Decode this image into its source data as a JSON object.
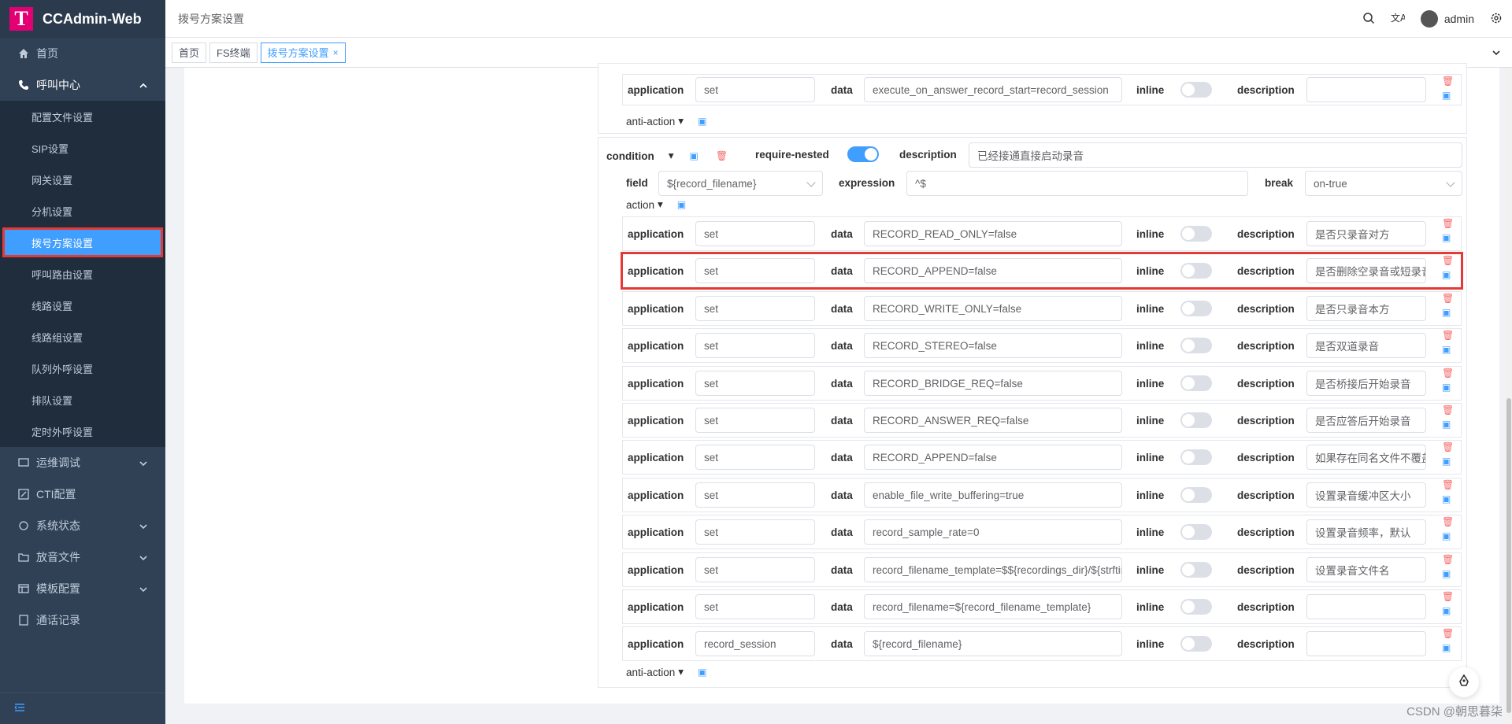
{
  "app": {
    "title": "CCAdmin-Web",
    "logo_letter": "T"
  },
  "sidebar": {
    "home": "首页",
    "callcenter": "呼叫中心",
    "callcenter_items": [
      "配置文件设置",
      "SIP设置",
      "网关设置",
      "分机设置",
      "拨号方案设置",
      "呼叫路由设置",
      "线路设置",
      "线路组设置",
      "队列外呼设置",
      "排队设置",
      "定时外呼设置"
    ],
    "active_index": 4,
    "groups": [
      "运维调试",
      "CTI配置",
      "系统状态",
      "放音文件",
      "模板配置",
      "通话记录"
    ]
  },
  "header": {
    "breadcrumb": "拨号方案设置",
    "user": "admin"
  },
  "tabs": [
    "首页",
    "FS终端",
    "拨号方案设置"
  ],
  "active_tab": 2,
  "top_row": {
    "application_label": "application",
    "application": "set",
    "data_label": "data",
    "data": "execute_on_answer_record_start=record_session",
    "inline_label": "inline",
    "description_label": "description",
    "description": ""
  },
  "anti_action_label": "anti-action",
  "condition": {
    "label": "condition",
    "require_nested_label": "require-nested",
    "require_nested": true,
    "description_label": "description",
    "description": "已经接通直接启动录音",
    "field_label": "field",
    "field": "${record_filename}",
    "expression_label": "expression",
    "expression": "^$",
    "break_label": "break",
    "break": "on-true",
    "action_label": "action"
  },
  "actions": [
    {
      "application": "set",
      "data": "RECORD_READ_ONLY=false",
      "description": "是否只录音对方"
    },
    {
      "application": "set",
      "data": "RECORD_APPEND=false",
      "description": "是否删除空录音或短录音"
    },
    {
      "application": "set",
      "data": "RECORD_WRITE_ONLY=false",
      "description": "是否只录音本方"
    },
    {
      "application": "set",
      "data": "RECORD_STEREO=false",
      "description": "是否双道录音"
    },
    {
      "application": "set",
      "data": "RECORD_BRIDGE_REQ=false",
      "description": "是否桥接后开始录音"
    },
    {
      "application": "set",
      "data": "RECORD_ANSWER_REQ=false",
      "description": "是否应答后开始录音"
    },
    {
      "application": "set",
      "data": "RECORD_APPEND=false",
      "description": "如果存在同名文件不覆盖"
    },
    {
      "application": "set",
      "data": "enable_file_write_buffering=true",
      "description": "设置录音缓冲区大小"
    },
    {
      "application": "set",
      "data": "record_sample_rate=0",
      "description": "设置录音频率，默认"
    },
    {
      "application": "set",
      "data": "record_filename_template=$${recordings_dir}/${strftime}",
      "description": "设置录音文件名"
    },
    {
      "application": "set",
      "data": "record_filename=${record_filename_template}",
      "description": ""
    },
    {
      "application": "record_session",
      "data": "${record_filename}",
      "description": ""
    }
  ],
  "row_labels": {
    "application": "application",
    "data": "data",
    "inline": "inline",
    "description": "description"
  },
  "watermark": "CSDN @朝思暮柒"
}
